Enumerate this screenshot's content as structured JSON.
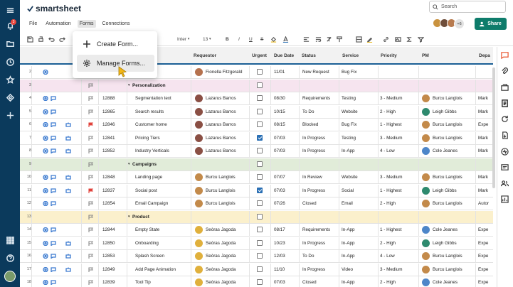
{
  "app": {
    "brand": "smartsheet",
    "notification_count": "3"
  },
  "search": {
    "placeholder": "Search"
  },
  "menus": [
    "File",
    "Automation",
    "Forms",
    "Connections"
  ],
  "header": {
    "more_collaborators": "+6",
    "share_label": "Share"
  },
  "toolbar": {
    "font": "Inter",
    "font_size": "13",
    "bold": "B",
    "italic": "I",
    "underline": "U",
    "strike": "S"
  },
  "dropdown": {
    "create_label": "Create Form...",
    "manage_label": "Manage Forms..."
  },
  "columns": [
    "Requestor",
    "Urgent",
    "Due Date",
    "Status",
    "Service",
    "Priority",
    "PM",
    "Depa"
  ],
  "rows": [
    {
      "n": "2",
      "id": "",
      "task": "",
      "requestor": "Fionella Fitzgerald",
      "urgent": false,
      "due": "11/01",
      "status": "New Request",
      "service": "Bug Fix",
      "priority": "",
      "pm": "",
      "dept": "",
      "flag": "none",
      "icons": [
        "at"
      ]
    },
    {
      "n": "3",
      "group": "Personalization"
    },
    {
      "n": "4",
      "id": "12888",
      "task": "Segmentation text",
      "requestor": "Lazarus Barros",
      "urgent": false,
      "due": "08/30",
      "status": "Requirements",
      "service": "Testing",
      "priority": "3 - Medium",
      "pm": "Burcu Langlois",
      "dept": "Mark",
      "flag": "outline",
      "icons": [
        "at",
        "chat"
      ]
    },
    {
      "n": "5",
      "id": "12865",
      "task": "Search results",
      "requestor": "Lazarus Barros",
      "urgent": false,
      "due": "10/15",
      "status": "To Do",
      "service": "Website",
      "priority": "2 - High",
      "pm": "Leigh Gibbs",
      "dept": "Mark",
      "flag": "outline",
      "icons": [
        "at",
        "chat"
      ]
    },
    {
      "n": "6",
      "id": "12846",
      "task": "Customer home",
      "requestor": "Lazarus Barros",
      "urgent": false,
      "due": "08/15",
      "status": "Blocked",
      "service": "Bug Fix",
      "priority": "1 - Highest",
      "pm": "Burcu Langlois",
      "dept": "Expe",
      "flag": "red",
      "icons": [
        "at",
        "chat",
        "bot"
      ]
    },
    {
      "n": "7",
      "id": "12841",
      "task": "Pricing Tiers",
      "requestor": "Lazarus Barros",
      "urgent": true,
      "due": "07/03",
      "status": "In Progress",
      "service": "Testing",
      "priority": "3 - Medium",
      "pm": "Burcu Langlois",
      "dept": "Mark",
      "flag": "outline",
      "icons": [
        "at",
        "chat",
        "bot"
      ]
    },
    {
      "n": "8",
      "id": "12852",
      "task": "Industry Verticals",
      "requestor": "Lazarus Barros",
      "urgent": false,
      "due": "07/03",
      "status": "In Progress",
      "service": "In-App",
      "priority": "4 - Low",
      "pm": "Cole Jeanes",
      "dept": "Mark",
      "flag": "outline",
      "icons": [
        "at",
        "chat",
        "bot"
      ]
    },
    {
      "n": "9",
      "group": "Campaigns"
    },
    {
      "n": "10",
      "id": "12848",
      "task": "Landing page",
      "requestor": "Burcu Langlois",
      "urgent": false,
      "due": "07/07",
      "status": "In Review",
      "service": "Website",
      "priority": "3 - Medium",
      "pm": "Burcu Langlois",
      "dept": "Mark",
      "flag": "outline",
      "icons": [
        "at",
        "chat",
        "bot"
      ]
    },
    {
      "n": "11",
      "id": "12837",
      "task": "Social post",
      "requestor": "Burcu Langlois",
      "urgent": true,
      "due": "07/03",
      "status": "In Progress",
      "service": "Social",
      "priority": "1 - Highest",
      "pm": "Leigh Gibbs",
      "dept": "Mark",
      "flag": "red",
      "icons": [
        "at",
        "chat",
        "bot"
      ]
    },
    {
      "n": "12",
      "id": "12854",
      "task": "Email Campaign",
      "requestor": "Burcu Langlois",
      "urgent": false,
      "due": "07/26",
      "status": "Closed",
      "service": "Email",
      "priority": "2 - High",
      "pm": "Burcu Langlois",
      "dept": "Autor",
      "flag": "outline",
      "icons": [
        "at",
        "chat"
      ]
    },
    {
      "n": "13",
      "group": "Product"
    },
    {
      "n": "14",
      "id": "12844",
      "task": "Empty State",
      "requestor": "Seòras Jagoda",
      "urgent": false,
      "due": "08/17",
      "status": "Requirements",
      "service": "In-App",
      "priority": "1 - Highest",
      "pm": "Cole Jeanes",
      "dept": "Expe",
      "flag": "outline",
      "icons": [
        "at",
        "chat"
      ]
    },
    {
      "n": "15",
      "id": "12850",
      "task": "Onboarding",
      "requestor": "Seòras Jagoda",
      "urgent": false,
      "due": "10/23",
      "status": "In Progress",
      "service": "In-App",
      "priority": "2 - High",
      "pm": "Leigh Gibbs",
      "dept": "Expe",
      "flag": "outline",
      "icons": [
        "at",
        "chat",
        "bot"
      ]
    },
    {
      "n": "16",
      "id": "12853",
      "task": "Splash Screen",
      "requestor": "Seòras Jagoda",
      "urgent": false,
      "due": "12/03",
      "status": "To Do",
      "service": "In-App",
      "priority": "4 - Low",
      "pm": "Burcu Langlois",
      "dept": "Expe",
      "flag": "outline",
      "icons": [
        "at",
        "chat",
        "bot"
      ]
    },
    {
      "n": "17",
      "id": "12849",
      "task": "Add Page Animation",
      "requestor": "Seòras Jagoda",
      "urgent": false,
      "due": "11/10",
      "status": "In Progress",
      "service": "Video",
      "priority": "3 - Medium",
      "pm": "Burcu Langlois",
      "dept": "Expe",
      "flag": "outline",
      "icons": [
        "at",
        "chat",
        "bot"
      ]
    },
    {
      "n": "18",
      "id": "12839",
      "task": "Tool Tip",
      "requestor": "Seòras Jagoda",
      "urgent": false,
      "due": "07/03",
      "status": "Closed",
      "service": "In-App",
      "priority": "2 - High",
      "pm": "Cole Jeanes",
      "dept": "Expe",
      "flag": "outline",
      "icons": [
        "at",
        "chat"
      ]
    }
  ],
  "colors": {
    "rail": "#0b3a5c",
    "share": "#0e7c6b",
    "group_personalization": "#f6e4ef",
    "group_campaigns": "#e1ecd9",
    "group_product": "#fbf0cc",
    "person_colors": {
      "Fionella Fitzgerald": "#b5714d",
      "Lazarus Barros": "#8a4f44",
      "Burcu Langlois": "#c38a4a",
      "Seòras Jagoda": "#e0b03c",
      "Leigh Gibbs": "#2e8a6e",
      "Cole Jeanes": "#4d86c9"
    }
  }
}
